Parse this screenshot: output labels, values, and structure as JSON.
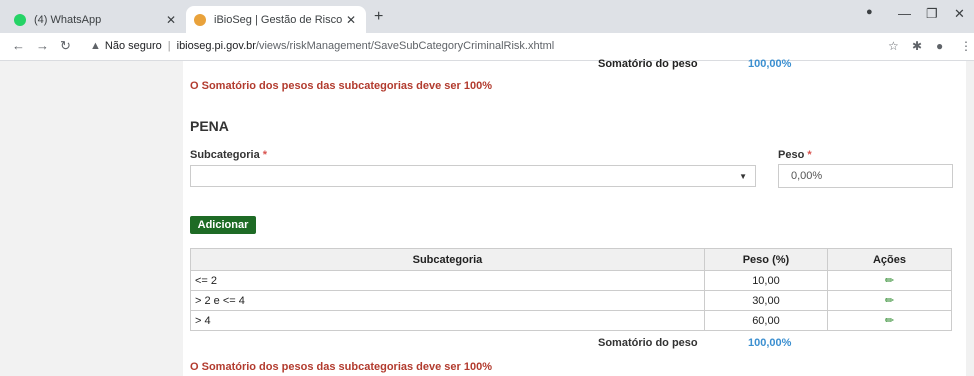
{
  "browser": {
    "tabs": [
      {
        "title": "(4) WhatsApp"
      },
      {
        "title": "iBioSeg | Gestão de Risco"
      }
    ],
    "security_label": "Não seguro",
    "url_host": "ibioseg.pi.gov.br",
    "url_path": "/views/riskManagement/SaveSubCategoryCriminalRisk.xhtml"
  },
  "top_fragment": {
    "sum_label": "Somatório do peso",
    "sum_value": "100,00%",
    "error": "O Somatório dos pesos das subcategorias deve ser 100%"
  },
  "section": {
    "title": "PENA",
    "subcategory_label": "Subcategoria",
    "weight_label": "Peso",
    "required_mark": "*",
    "weight_value": "0,00%",
    "add_button": "Adicionar"
  },
  "table": {
    "headers": {
      "subcategory": "Subcategoria",
      "weight": "Peso (%)",
      "actions": "Ações"
    },
    "rows": [
      {
        "subcategory": "<= 2",
        "weight": "10,00"
      },
      {
        "subcategory": "> 2 e <= 4",
        "weight": "30,00"
      },
      {
        "subcategory": "> 4",
        "weight": "60,00"
      }
    ],
    "sum_label": "Somatório do peso",
    "sum_value": "100,00%"
  },
  "bottom_error": "O Somatório dos pesos das subcategorias deve ser 100%",
  "colors": {
    "error": "#b23b2e",
    "button": "#1e6b25",
    "sum": "#3b8fd0"
  }
}
